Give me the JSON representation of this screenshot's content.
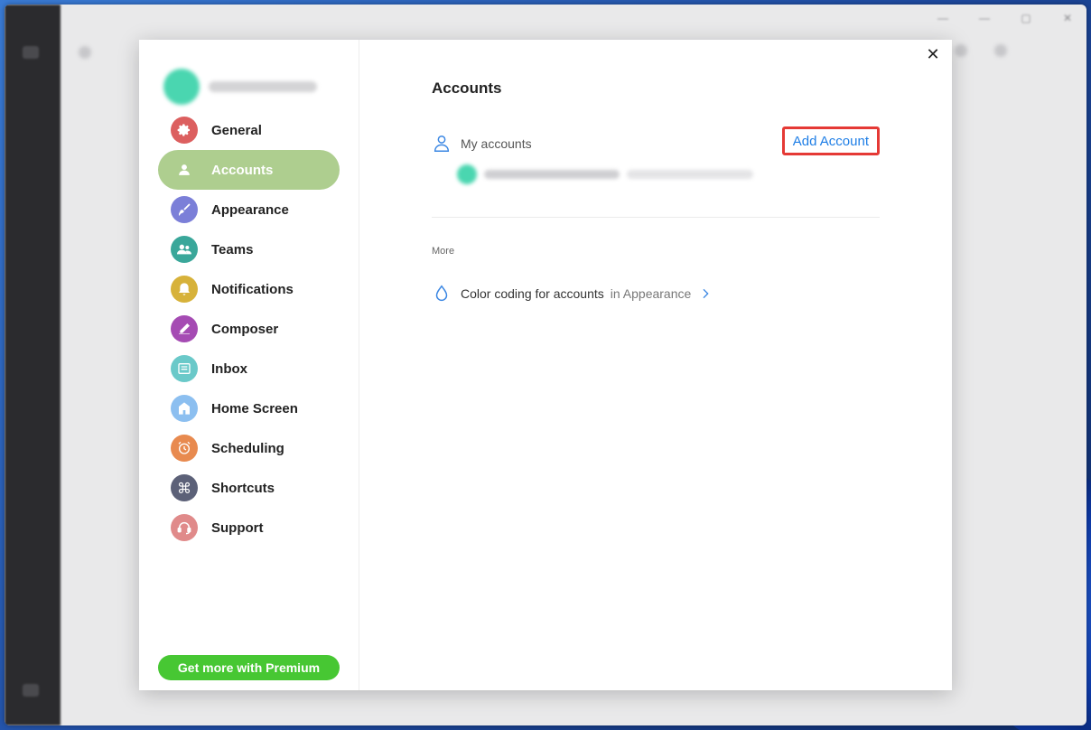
{
  "dialog": {
    "title": "Accounts",
    "close_glyph": "✕"
  },
  "sidebar": {
    "items": [
      {
        "label": "General",
        "icon": "gear-icon",
        "color": "#dc5f5f"
      },
      {
        "label": "Accounts",
        "icon": "person-icon",
        "color": "#aece8f",
        "active": true
      },
      {
        "label": "Appearance",
        "icon": "brush-icon",
        "color": "#7b7fd8"
      },
      {
        "label": "Teams",
        "icon": "people-icon",
        "color": "#3aa79a"
      },
      {
        "label": "Notifications",
        "icon": "bell-icon",
        "color": "#d7b23a"
      },
      {
        "label": "Composer",
        "icon": "pencil-icon",
        "color": "#a54bb3"
      },
      {
        "label": "Inbox",
        "icon": "inbox-icon",
        "color": "#6ac9c9"
      },
      {
        "label": "Home Screen",
        "icon": "home-icon",
        "color": "#8cbff0"
      },
      {
        "label": "Scheduling",
        "icon": "alarm-clock-icon",
        "color": "#e88a4f"
      },
      {
        "label": "Shortcuts",
        "icon": "command-icon",
        "color": "#5c6178"
      },
      {
        "label": "Support",
        "icon": "headset-icon",
        "color": "#e08a8a"
      }
    ],
    "premium_label": "Get more with Premium",
    "premium_color": "#47c733"
  },
  "main": {
    "my_accounts_label": "My accounts",
    "add_account_label": "Add Account",
    "more_label": "More",
    "color_coding_label": "Color coding for accounts",
    "color_coding_sub": "in Appearance"
  },
  "colors": {
    "accent": "#1e7ee6",
    "highlight_border": "#e53935",
    "active_nav": "#aece8f"
  }
}
